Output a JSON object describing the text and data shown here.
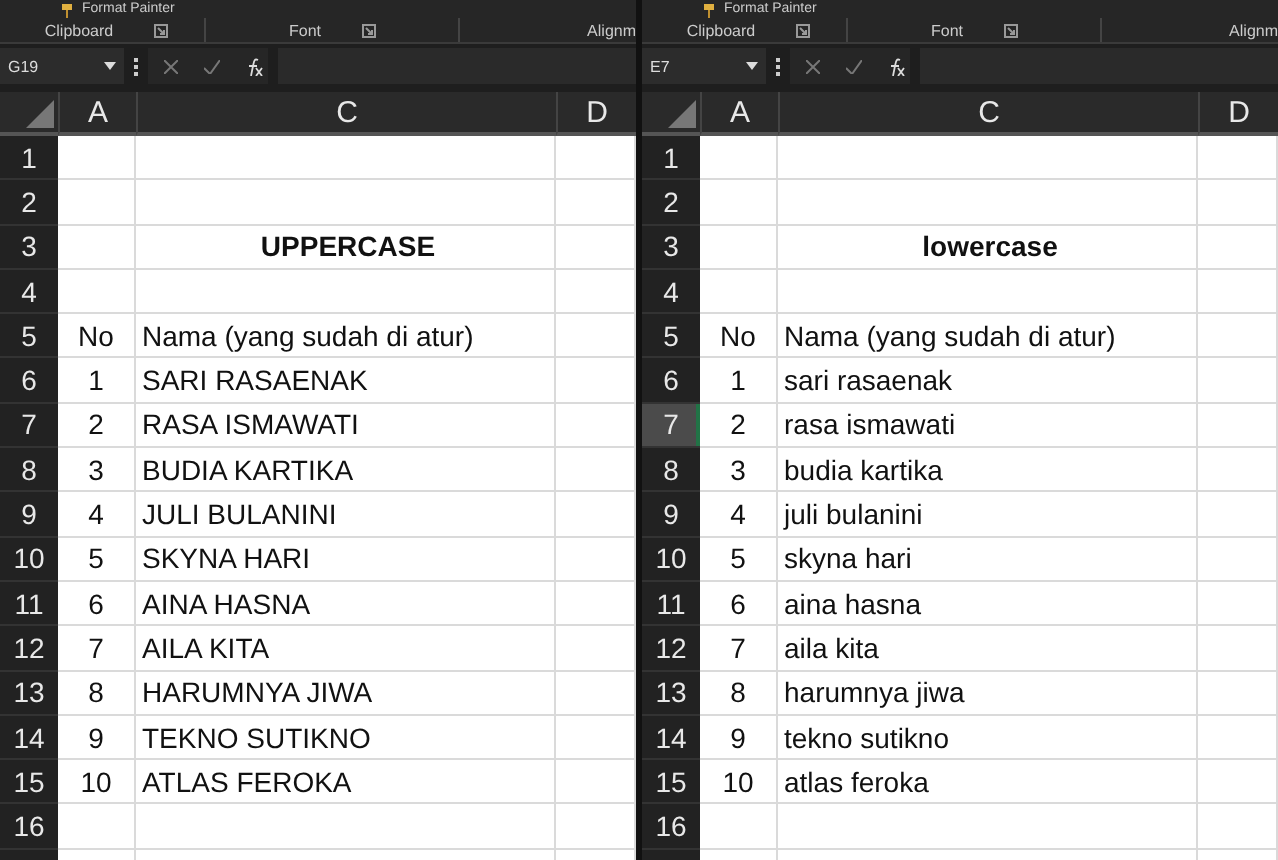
{
  "panes": [
    {
      "ribbon": {
        "button": "Format Painter",
        "groups": [
          "Clipboard",
          "Font",
          "Alignm"
        ]
      },
      "name_box": "G19",
      "columns": [
        "A",
        "C",
        "D"
      ],
      "rows": [
        {
          "header": "1",
          "selected": false,
          "cells": [
            "",
            ""
          ]
        },
        {
          "header": "2",
          "selected": false,
          "cells": [
            "",
            ""
          ]
        },
        {
          "header": "3",
          "selected": false,
          "kind": "title",
          "cells": [
            "",
            "UPPERCASE"
          ]
        },
        {
          "header": "4",
          "selected": false,
          "cells": [
            "",
            ""
          ]
        },
        {
          "header": "5",
          "selected": false,
          "cells": [
            "No",
            "Nama (yang sudah di atur)"
          ]
        },
        {
          "header": "6",
          "selected": false,
          "cells": [
            "1",
            "SARI RASAENAK"
          ]
        },
        {
          "header": "7",
          "selected": false,
          "cells": [
            "2",
            "RASA ISMAWATI"
          ]
        },
        {
          "header": "8",
          "selected": false,
          "cells": [
            "3",
            "BUDIA KARTIKA"
          ]
        },
        {
          "header": "9",
          "selected": false,
          "cells": [
            "4",
            "JULI BULANINI"
          ]
        },
        {
          "header": "10",
          "selected": false,
          "cells": [
            "5",
            "SKYNA HARI"
          ]
        },
        {
          "header": "11",
          "selected": false,
          "cells": [
            "6",
            "AINA HASNA"
          ]
        },
        {
          "header": "12",
          "selected": false,
          "cells": [
            "7",
            "AILA KITA"
          ]
        },
        {
          "header": "13",
          "selected": false,
          "cells": [
            "8",
            "HARUMNYA JIWA"
          ]
        },
        {
          "header": "14",
          "selected": false,
          "cells": [
            "9",
            "TEKNO SUTIKNO"
          ]
        },
        {
          "header": "15",
          "selected": false,
          "cells": [
            "10",
            "ATLAS FEROKA"
          ]
        },
        {
          "header": "16",
          "selected": false,
          "cells": [
            "",
            ""
          ]
        }
      ]
    },
    {
      "ribbon": {
        "button": "Format Painter",
        "groups": [
          "Clipboard",
          "Font",
          "Alignm"
        ]
      },
      "name_box": "E7",
      "columns": [
        "A",
        "C",
        "D"
      ],
      "rows": [
        {
          "header": "1",
          "selected": false,
          "cells": [
            "",
            ""
          ]
        },
        {
          "header": "2",
          "selected": false,
          "cells": [
            "",
            ""
          ]
        },
        {
          "header": "3",
          "selected": false,
          "kind": "title",
          "cells": [
            "",
            "lowercase"
          ]
        },
        {
          "header": "4",
          "selected": false,
          "cells": [
            "",
            ""
          ]
        },
        {
          "header": "5",
          "selected": false,
          "cells": [
            "No",
            "Nama (yang sudah di atur)"
          ]
        },
        {
          "header": "6",
          "selected": false,
          "cells": [
            "1",
            "sari rasaenak"
          ]
        },
        {
          "header": "7",
          "selected": true,
          "cells": [
            "2",
            "rasa ismawati"
          ]
        },
        {
          "header": "8",
          "selected": false,
          "cells": [
            "3",
            "budia kartika"
          ]
        },
        {
          "header": "9",
          "selected": false,
          "cells": [
            "4",
            "juli bulanini"
          ]
        },
        {
          "header": "10",
          "selected": false,
          "cells": [
            "5",
            "skyna hari"
          ]
        },
        {
          "header": "11",
          "selected": false,
          "cells": [
            "6",
            "aina hasna"
          ]
        },
        {
          "header": "12",
          "selected": false,
          "cells": [
            "7",
            "aila kita"
          ]
        },
        {
          "header": "13",
          "selected": false,
          "cells": [
            "8",
            "harumnya jiwa"
          ]
        },
        {
          "header": "14",
          "selected": false,
          "cells": [
            "9",
            "tekno sutikno"
          ]
        },
        {
          "header": "15",
          "selected": false,
          "cells": [
            "10",
            "atlas feroka"
          ]
        },
        {
          "header": "16",
          "selected": false,
          "cells": [
            "",
            ""
          ]
        }
      ]
    }
  ]
}
